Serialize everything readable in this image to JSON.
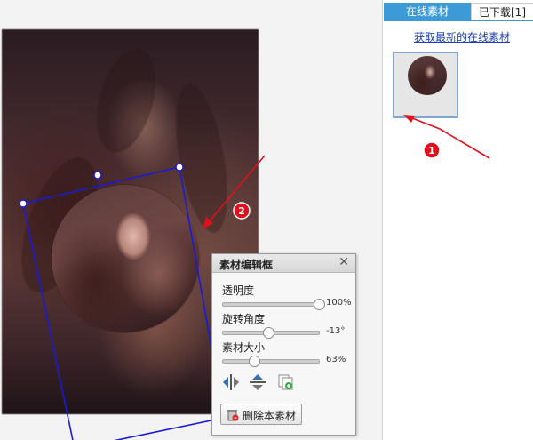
{
  "side_panel": {
    "tabs": [
      {
        "label": "在线素材",
        "active": true
      },
      {
        "label": "已下载[1]",
        "active": false
      }
    ],
    "link_text": "获取最新的在线素材",
    "accent_color": "#3c9bd6",
    "thumbnail_icon": "circle-portrait-thumbnail"
  },
  "editor": {
    "title": "素材编辑框",
    "close_icon": "close-icon",
    "sliders": [
      {
        "label": "透明度",
        "value_text": "100%",
        "value": 1.0
      },
      {
        "label": "旋转角度",
        "value_text": "-13°",
        "value": 0.47
      },
      {
        "label": "素材大小",
        "value_text": "63%",
        "value": 0.32
      }
    ],
    "tools": [
      "flip-horizontal-icon",
      "flip-vertical-icon",
      "copy-material-icon"
    ],
    "delete_label": "删除本素材"
  },
  "annotations": {
    "marker_1": "1",
    "marker_2": "2",
    "marker_color": "#e0111b"
  }
}
